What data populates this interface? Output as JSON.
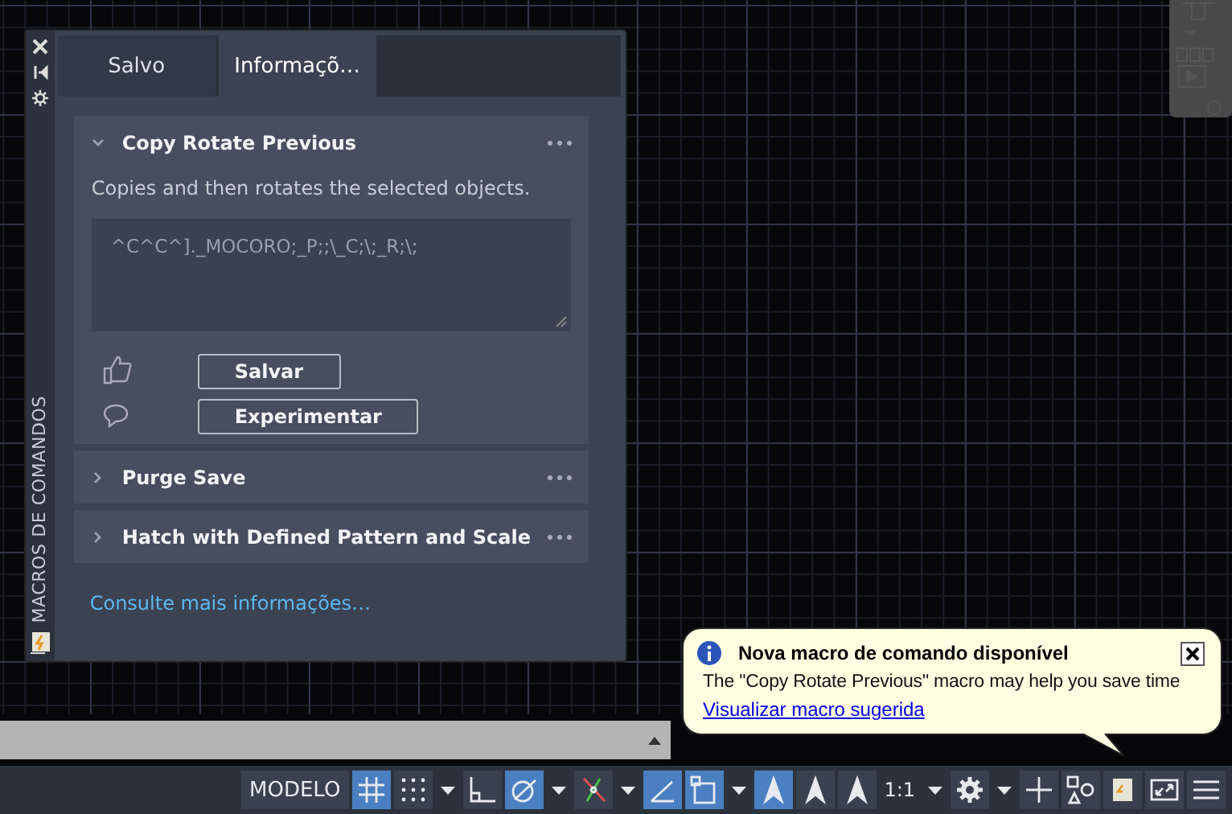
{
  "palette": {
    "side_title": "MACROS DE COMANDOS",
    "tabs": [
      {
        "label": "Salvo",
        "selected": false
      },
      {
        "label": "Informaçõ…",
        "selected": true
      }
    ],
    "macros": [
      {
        "title": "Copy Rotate Previous",
        "expanded": true,
        "description": "Copies and then rotates the selected objects.",
        "code": "^C^C^]._MOCORO;_P;;\\_C;\\;_R;\\;",
        "buttons": [
          "Salvar",
          "Experimentar"
        ]
      },
      {
        "title": "Purge Save",
        "expanded": false
      },
      {
        "title": "Hatch with Defined Pattern and Scale",
        "expanded": false
      }
    ],
    "link": "Consulte mais informações…"
  },
  "notification": {
    "title": "Nova macro de comando disponível",
    "message": "The \"Copy Rotate Previous\" macro may help you save time",
    "link": "Visualizar macro sugerida"
  },
  "status_bar": [
    {
      "kind": "label",
      "text": "MODELO"
    },
    {
      "kind": "grid",
      "on": true
    },
    {
      "kind": "snap",
      "on": false,
      "caret": true
    },
    {
      "kind": "ortho",
      "on": false
    },
    {
      "kind": "polar",
      "on": true,
      "caret": true
    },
    {
      "kind": "isodraft",
      "on": false,
      "caret": true
    },
    {
      "kind": "dynucs",
      "on": true
    },
    {
      "kind": "selcycle",
      "on": true,
      "caret": true
    },
    {
      "kind": "annovis",
      "on": true
    },
    {
      "kind": "autoscale",
      "on": false
    },
    {
      "kind": "annoscale",
      "on": false
    },
    {
      "kind": "scale",
      "text": "1:1",
      "caret": true
    },
    {
      "kind": "gear",
      "on": false,
      "caret": true
    },
    {
      "kind": "plus",
      "on": false
    },
    {
      "kind": "shapes",
      "on": false
    },
    {
      "kind": "macro",
      "on": false
    },
    {
      "kind": "fullscreen",
      "on": false
    },
    {
      "kind": "menu",
      "on": false
    }
  ]
}
